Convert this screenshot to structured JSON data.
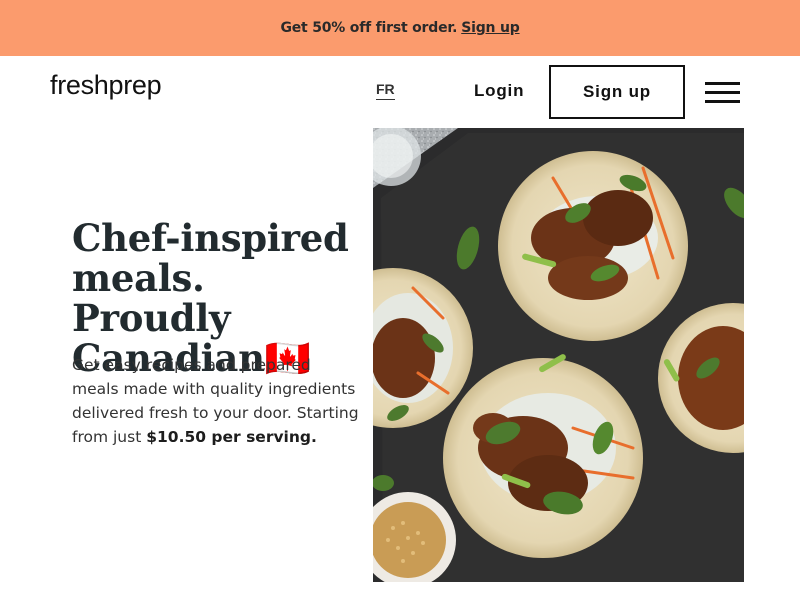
{
  "promo": {
    "text": "Get 50% off first order.",
    "link_label": "Sign up"
  },
  "header": {
    "logo": "freshprep",
    "language": "FR",
    "login_label": "Login",
    "signup_label": "Sign up",
    "menu_icon": "hamburger-menu-icon"
  },
  "hero": {
    "title": "Chef-inspired meals. Proudly Canadian🇨🇦",
    "subtitle": "Get easy recipes and prepared meals made with quality ingredients delivered fresh to your door. Starting from just",
    "price_text": "$10.50 per serving.",
    "image_alt": "Tacos with beef, cabbage slaw, carrots, basil and green onion on a dark slate board"
  },
  "colors": {
    "promo_bg": "#fb9b6d",
    "text_dark": "#222b2f",
    "slate": "#2b2b2b",
    "tortilla": "#e8dcbc",
    "basil": "#4d7a2e"
  }
}
